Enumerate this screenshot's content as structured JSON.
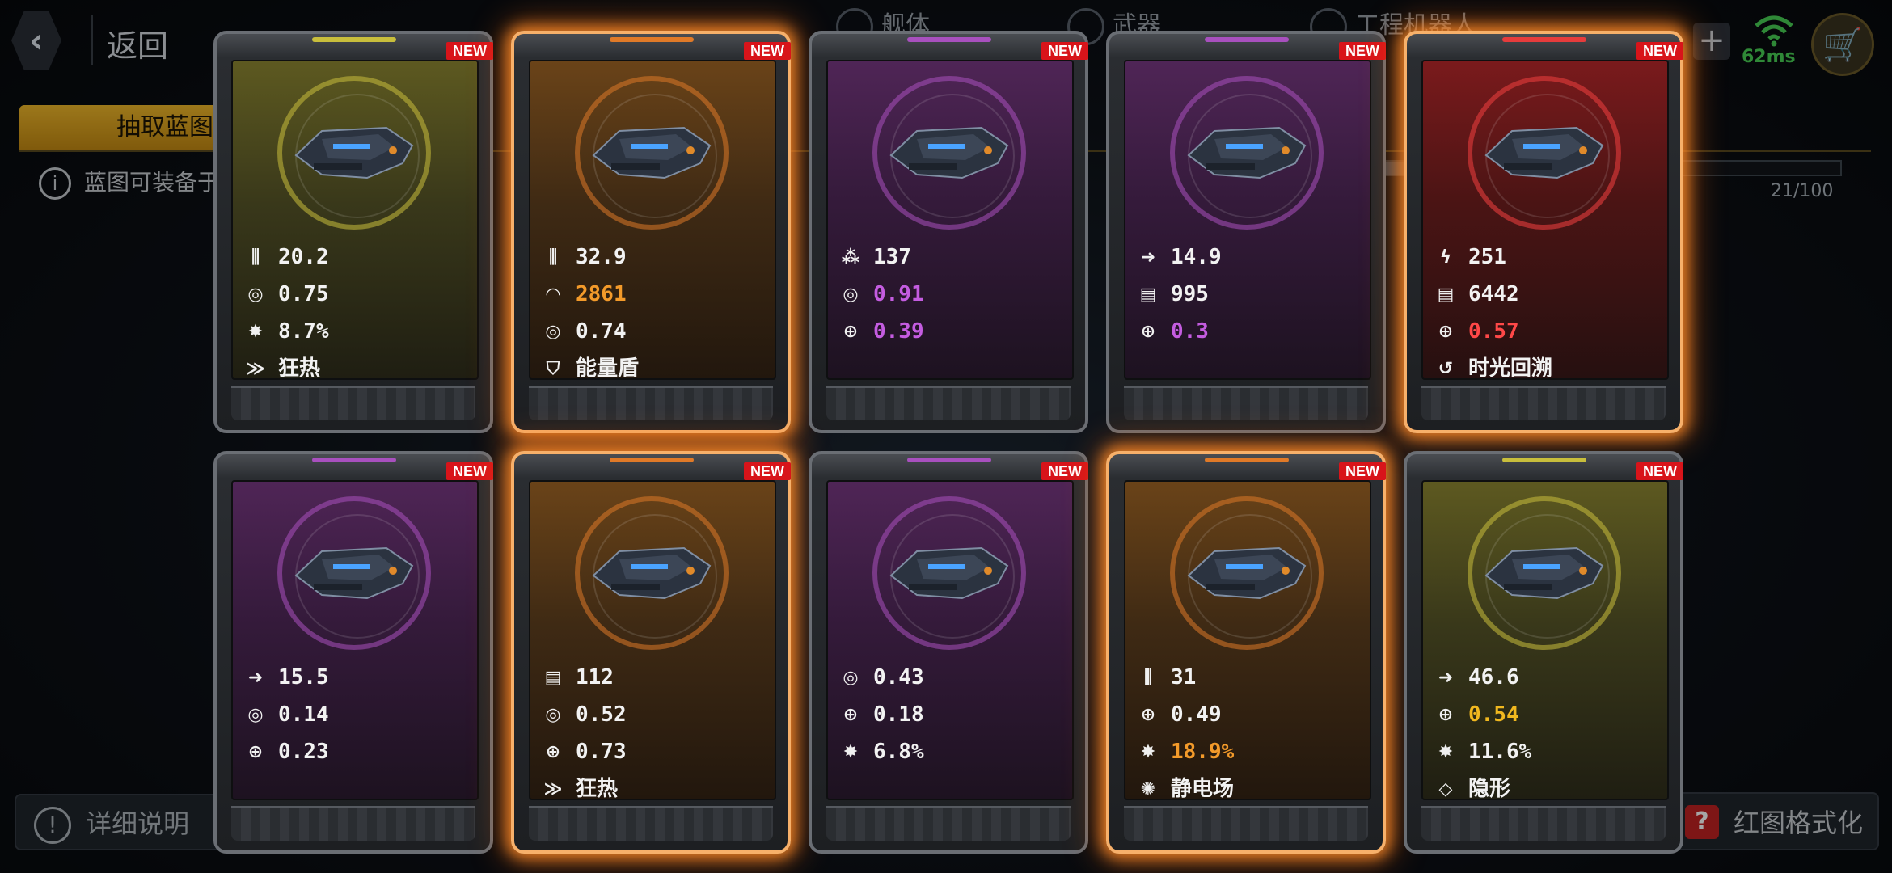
{
  "header": {
    "back_label": "返回",
    "tabs": [
      {
        "label": "舰体"
      },
      {
        "label": "武器"
      },
      {
        "label": "工程机器人"
      }
    ],
    "ping": "62ms"
  },
  "blueprint": {
    "tab_label": "抽取蓝图",
    "info_text": "蓝图可装备于",
    "progress_text": "21/100",
    "progress_fraction": 0.21
  },
  "footer": {
    "detail_label": "详细说明",
    "red_format_label": "红图格式化"
  },
  "colors": {
    "yellow": "#c8be3c",
    "orange": "#e07a28",
    "purple": "#a850be",
    "red": "#e63c3c",
    "new_badge": "#d8141a"
  },
  "cards": [
    {
      "rarity": "yellow",
      "glow": false,
      "new_label": "NEW",
      "stats": [
        {
          "icon": "ammo-icon",
          "value": "20.2",
          "color": "white"
        },
        {
          "icon": "cooldown-icon",
          "value": "0.75",
          "color": "white"
        },
        {
          "icon": "crit-icon",
          "value": "8.7%",
          "color": "white"
        },
        {
          "icon": "fanatic-icon",
          "value": "狂热",
          "color": "white"
        }
      ]
    },
    {
      "rarity": "orange",
      "glow": true,
      "new_label": "NEW",
      "stats": [
        {
          "icon": "ammo-icon",
          "value": "32.9",
          "color": "white"
        },
        {
          "icon": "shield-hp-icon",
          "value": "2861",
          "color": "orange"
        },
        {
          "icon": "cooldown-icon",
          "value": "0.74",
          "color": "white"
        },
        {
          "icon": "energy-shield-icon",
          "value": "能量盾",
          "color": "white"
        }
      ]
    },
    {
      "rarity": "purple",
      "glow": false,
      "new_label": "NEW",
      "stats": [
        {
          "icon": "cluster-icon",
          "value": "137",
          "color": "white"
        },
        {
          "icon": "cooldown-icon",
          "value": "0.91",
          "color": "purple"
        },
        {
          "icon": "accuracy-icon",
          "value": "0.39",
          "color": "purple"
        }
      ]
    },
    {
      "rarity": "purple",
      "glow": false,
      "new_label": "NEW",
      "stats": [
        {
          "icon": "speed-icon",
          "value": "14.9",
          "color": "white"
        },
        {
          "icon": "armor-icon",
          "value": "995",
          "color": "white"
        },
        {
          "icon": "accuracy-icon",
          "value": "0.3",
          "color": "purple"
        }
      ]
    },
    {
      "rarity": "red",
      "glow": true,
      "new_label": "NEW",
      "stats": [
        {
          "icon": "damage-icon",
          "value": "251",
          "color": "white"
        },
        {
          "icon": "armor-icon",
          "value": "6442",
          "color": "white"
        },
        {
          "icon": "accuracy-icon",
          "value": "0.57",
          "color": "red"
        },
        {
          "icon": "time-rewind-icon",
          "value": "时光回溯",
          "color": "white"
        }
      ]
    },
    {
      "rarity": "purple",
      "glow": false,
      "new_label": "NEW",
      "stats": [
        {
          "icon": "speed-icon",
          "value": "15.5",
          "color": "white"
        },
        {
          "icon": "cooldown-icon",
          "value": "0.14",
          "color": "white"
        },
        {
          "icon": "accuracy-icon",
          "value": "0.23",
          "color": "white"
        }
      ]
    },
    {
      "rarity": "orange",
      "glow": true,
      "new_label": "NEW",
      "stats": [
        {
          "icon": "armor-icon",
          "value": "112",
          "color": "white"
        },
        {
          "icon": "cooldown-icon",
          "value": "0.52",
          "color": "white"
        },
        {
          "icon": "accuracy-icon",
          "value": "0.73",
          "color": "white"
        },
        {
          "icon": "fanatic-icon",
          "value": "狂热",
          "color": "white"
        }
      ]
    },
    {
      "rarity": "purple",
      "glow": false,
      "new_label": "NEW",
      "stats": [
        {
          "icon": "cooldown-icon",
          "value": "0.43",
          "color": "white"
        },
        {
          "icon": "accuracy-icon",
          "value": "0.18",
          "color": "white"
        },
        {
          "icon": "crit-icon",
          "value": "6.8%",
          "color": "white"
        }
      ]
    },
    {
      "rarity": "orange",
      "glow": true,
      "new_label": "NEW",
      "stats": [
        {
          "icon": "ammo-icon",
          "value": "31",
          "color": "white"
        },
        {
          "icon": "accuracy-icon",
          "value": "0.49",
          "color": "white"
        },
        {
          "icon": "crit-icon",
          "value": "18.9%",
          "color": "orange"
        },
        {
          "icon": "static-field-icon",
          "value": "静电场",
          "color": "white"
        }
      ]
    },
    {
      "rarity": "yellow",
      "glow": false,
      "new_label": "NEW",
      "stats": [
        {
          "icon": "speed-icon",
          "value": "46.6",
          "color": "white"
        },
        {
          "icon": "accuracy-icon",
          "value": "0.54",
          "color": "gold"
        },
        {
          "icon": "crit-icon",
          "value": "11.6%",
          "color": "white"
        },
        {
          "icon": "stealth-icon",
          "value": "隐形",
          "color": "white"
        }
      ]
    }
  ]
}
